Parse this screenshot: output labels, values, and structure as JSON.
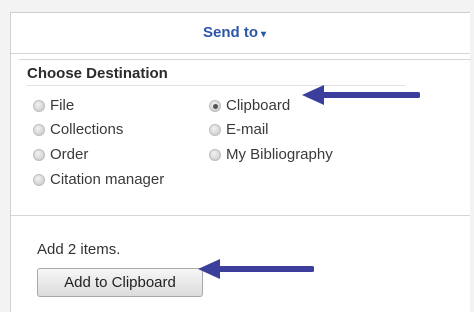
{
  "menu": {
    "send_to_label": "Send to",
    "caret": "▾"
  },
  "destination": {
    "title": "Choose Destination",
    "options": [
      {
        "label": "File",
        "selected": false
      },
      {
        "label": "Clipboard",
        "selected": true
      },
      {
        "label": "Collections",
        "selected": false
      },
      {
        "label": "E-mail",
        "selected": false
      },
      {
        "label": "Order",
        "selected": false
      },
      {
        "label": "My Bibliography",
        "selected": false
      },
      {
        "label": "Citation manager",
        "selected": false
      }
    ]
  },
  "action": {
    "item_count_text": "Add 2 items.",
    "button_label": "Add to Clipboard"
  },
  "colors": {
    "link": "#2c56a8",
    "annotation_arrow": "#3b3e9a"
  }
}
